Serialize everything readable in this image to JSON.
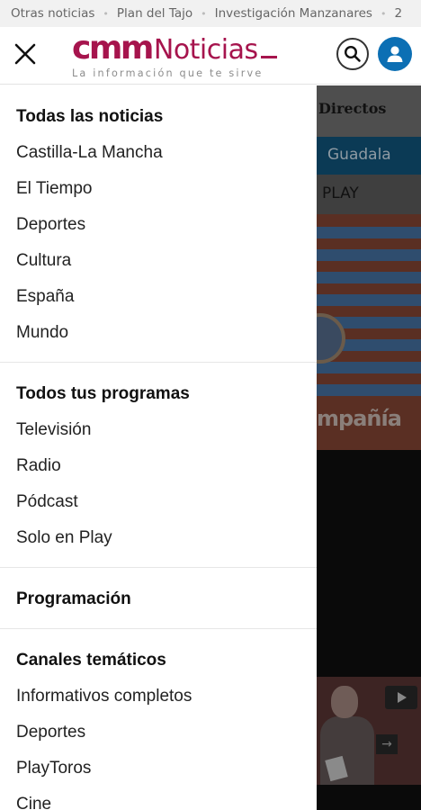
{
  "tagbar": {
    "tags": [
      "Otras noticias",
      "Plan del Tajo",
      "Investigación Manzanares",
      "2"
    ]
  },
  "header": {
    "logo_brand": "cmm",
    "logo_name": "Noticias",
    "slogan": "La información que te sirve",
    "brand_color": "#a6144d",
    "user_color": "#0c6fb4",
    "icons": [
      "close-icon",
      "search-icon",
      "user-icon"
    ]
  },
  "background_page": {
    "directos": "Directos",
    "band_text": "Guadala",
    "play_text": "PLAY",
    "promo_text": "mpañía"
  },
  "menu": {
    "sections": [
      {
        "title": "Todas las noticias",
        "items": [
          "Castilla-La Mancha",
          "El Tiempo",
          "Deportes",
          "Cultura",
          "España",
          "Mundo"
        ]
      },
      {
        "title": "Todos tus programas",
        "items": [
          "Televisión",
          "Radio",
          "Pódcast",
          "Solo en Play"
        ]
      },
      {
        "title": "Programación",
        "items": []
      },
      {
        "title": "Canales temáticos",
        "items": [
          "Informativos completos",
          "Deportes",
          "PlayToros",
          "Cine"
        ]
      }
    ]
  }
}
